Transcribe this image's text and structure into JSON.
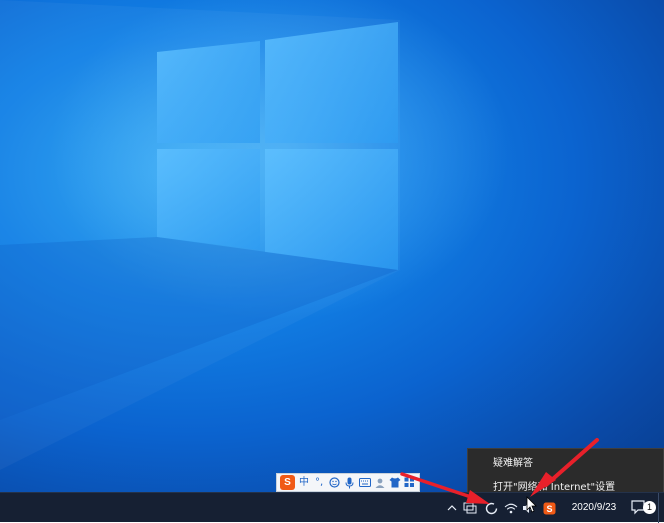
{
  "desktop": {
    "wallpaper": "windows-10-logo-light"
  },
  "ime_toolbar": {
    "logo_label": "S",
    "mode_label": "中",
    "punct_label": "°,",
    "emoji_icon": "emoji-icon",
    "mic_icon": "microphone-icon",
    "keyboard_icon": "keyboard-icon",
    "user_icon": "user-icon",
    "skin_icon": "shirt-icon",
    "grid_icon": "grid-icon"
  },
  "context_menu": {
    "items": [
      {
        "label": "疑难解答"
      },
      {
        "label": "打开\"网络和 Internet\"设置"
      }
    ]
  },
  "taskbar": {
    "tray_icons": [
      "chevron-up-icon",
      "network-icon",
      "loading-icon",
      "wifi-icon",
      "volume-icon",
      "sogou-icon"
    ],
    "clock_date": "2020/9/23",
    "notification_count": "1"
  },
  "colors": {
    "annotation_arrow": "#e8202a",
    "taskbar": "#162033",
    "menu_background": "#2b2b2b"
  }
}
